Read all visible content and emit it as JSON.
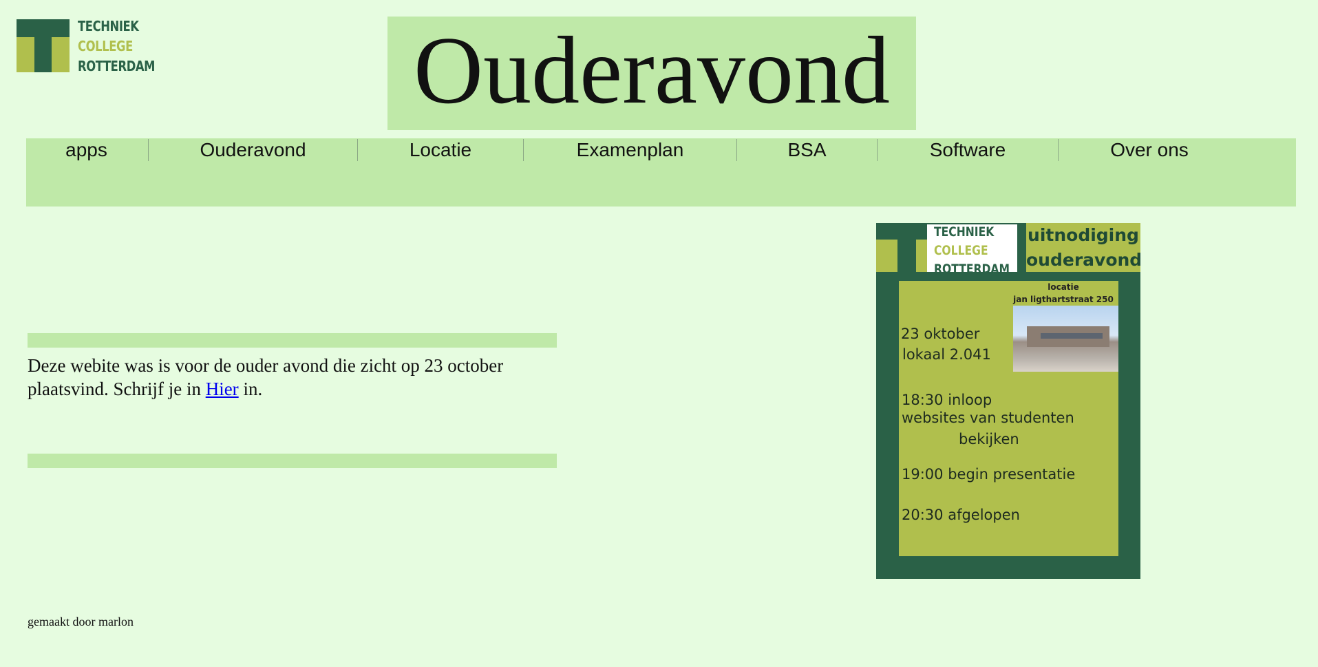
{
  "logo": {
    "line1": "TECHNIEK",
    "line2": "COLLEGE",
    "line3": "ROTTERDAM"
  },
  "page_title": "Ouderavond",
  "nav": {
    "items": [
      {
        "label": "apps"
      },
      {
        "label": "Ouderavond"
      },
      {
        "label": "Locatie"
      },
      {
        "label": "Examenplan"
      },
      {
        "label": "BSA"
      },
      {
        "label": "Software"
      },
      {
        "label": "Over ons"
      }
    ]
  },
  "content": {
    "text_before": "Deze webite was is voor de ouder avond die zicht op 23 october plaatsvind. Schrijf je in ",
    "link": "Hier",
    "text_after": " in."
  },
  "poster": {
    "logo_line1": "TECHNIEK",
    "logo_line2": "COLLEGE",
    "logo_line3": "ROTTERDAM",
    "invite_line1": "uitnodiging",
    "invite_line2": "ouderavond",
    "location_label": "locatie",
    "location_address": "jan ligthartstraat 250",
    "date": "23 oktober",
    "room": "lokaal 2.041",
    "walkin": "18:30 inloop",
    "walkin_detail1": "websites van studenten",
    "walkin_detail2": "bekijken",
    "presentation": "19:00 begin presentatie",
    "end": "20:30 afgelopen"
  },
  "footer": "gemaakt door marlon",
  "colors": {
    "background": "#e6fce0",
    "panel": "#bfe9a8",
    "brand_green": "#2a6147",
    "brand_lime": "#b0bf4d",
    "link": "#0000ee"
  }
}
